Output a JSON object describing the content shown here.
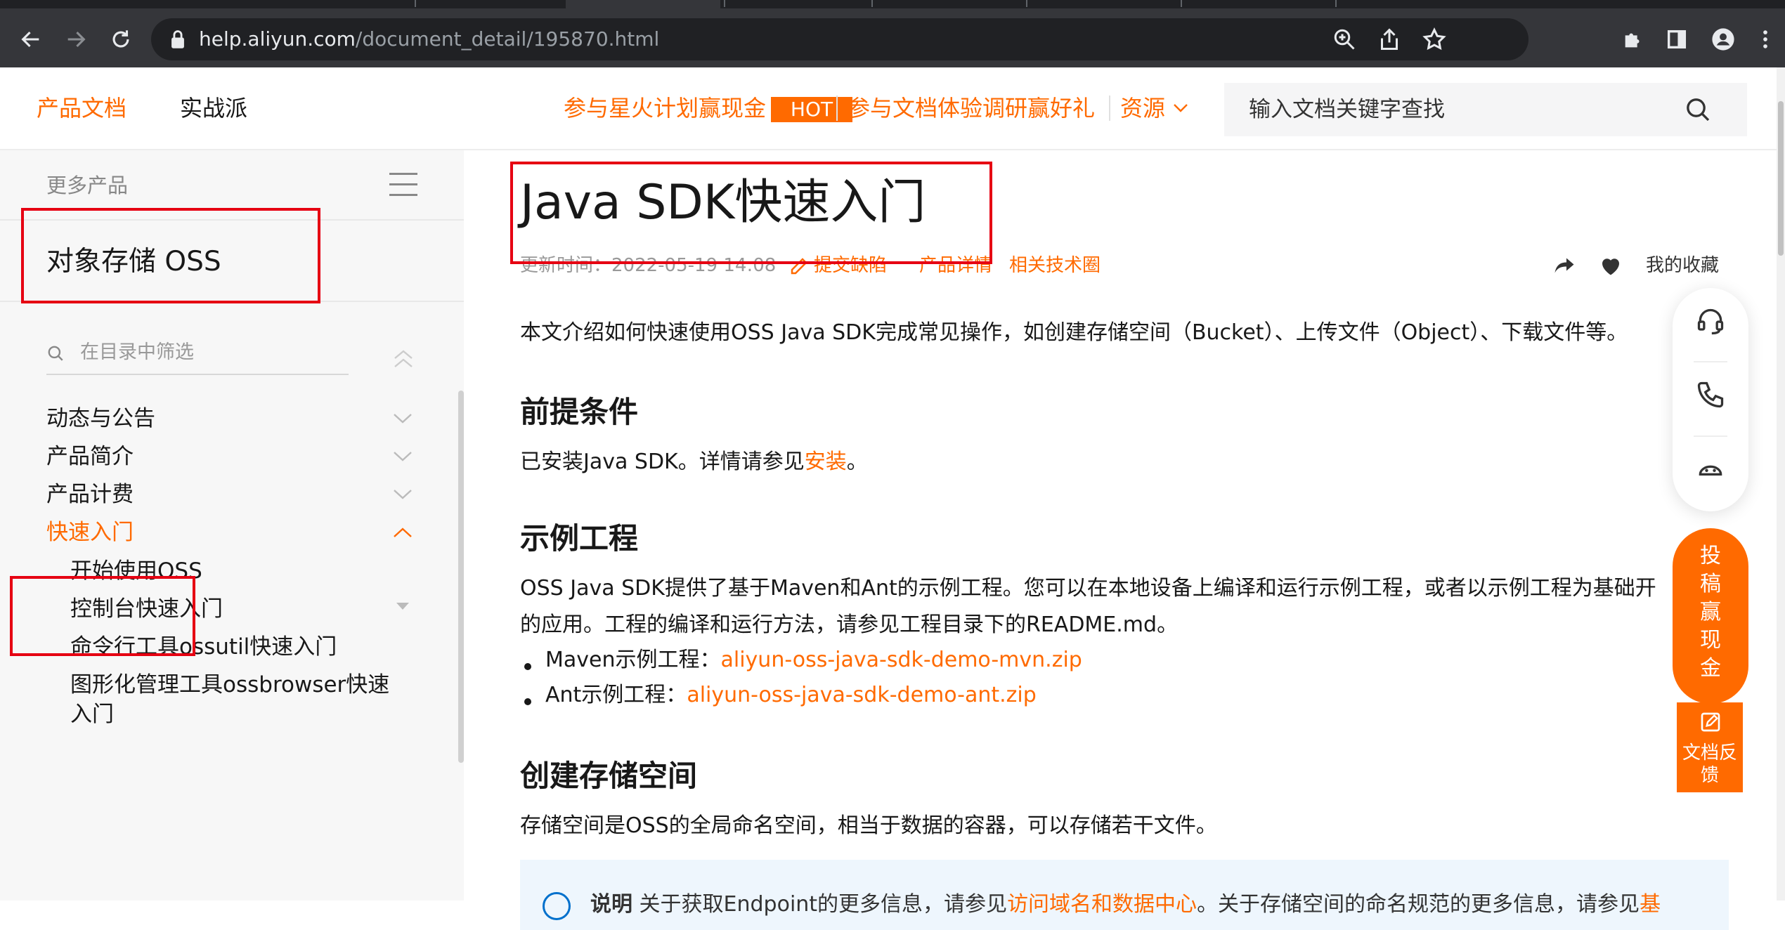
{
  "browser": {
    "url_host": "help.aliyun.com",
    "url_path": "/document_detail/195870.html"
  },
  "header": {
    "nav": [
      "产品文档",
      "实战派"
    ],
    "promo1": "参与星火计划赢现金",
    "hot_badge": "HOT",
    "promo2": "参与文档体验调研赢好礼",
    "resources": "资源",
    "search_placeholder": "输入文档关键字查找"
  },
  "sidebar": {
    "more_products": "更多产品",
    "product": "对象存储 OSS",
    "filter_placeholder": "在目录中筛选",
    "items": [
      {
        "label": "动态与公告"
      },
      {
        "label": "产品简介"
      },
      {
        "label": "产品计费"
      },
      {
        "label": "快速入门"
      }
    ],
    "sub_items": [
      {
        "label": "开始使用OSS"
      },
      {
        "label": "控制台快速入门"
      },
      {
        "label": "命令行工具ossutil快速入门"
      },
      {
        "label": "图形化管理工具ossbrowser快速入门"
      }
    ]
  },
  "doc": {
    "title": "Java SDK快速入门",
    "updated": "更新时间：2022-05-19 14:08",
    "report_bug": "提交缺陷",
    "product_detail": "产品详情",
    "tech_circle": "相关技术圈",
    "favorites": "我的收藏",
    "intro": "本文介绍如何快速使用OSS Java SDK完成常见操作，如创建存储空间（Bucket）、上传文件（Object）、下载文件等。",
    "h_prereq": "前提条件",
    "prereq_text": "已安装Java SDK。详情请参见",
    "prereq_link": "安装",
    "prereq_end": "。",
    "h_sample": "示例工程",
    "sample_line1": "OSS Java SDK提供了基于Maven和Ant的示例工程。您可以在本地设备上编译和运行示例工程，或者以示例工程为基础开",
    "sample_line2": "的应用。工程的编译和运行方法，请参见工程目录下的README.md。",
    "maven_label": "Maven示例工程：",
    "maven_link": "aliyun-oss-java-sdk-demo-mvn.zip",
    "ant_label": "Ant示例工程：",
    "ant_link": "aliyun-oss-java-sdk-demo-ant.zip",
    "h_bucket": "创建存储空间",
    "bucket_text": "存储空间是OSS的全局命名空间，相当于数据的容器，可以存储若干文件。",
    "note_label": "说明",
    "note_text": " 关于获取Endpoint的更多信息，请参见",
    "note_link": "访问域名和数据中心",
    "note_text2": "。关于存储空间的命名规范的更多信息，请参见",
    "note_link2": "基"
  },
  "floating": {
    "contribute": "投稿赢现金",
    "feedback": "文档反馈"
  },
  "colors": {
    "accent": "#ff6a00",
    "annotation": "#e60012"
  }
}
